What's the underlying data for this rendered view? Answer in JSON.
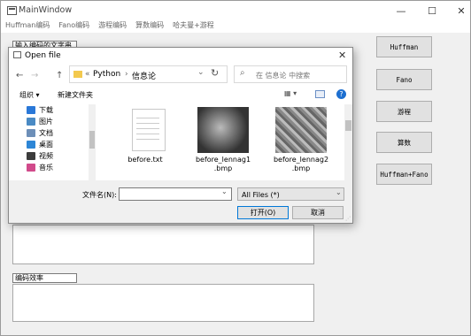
{
  "window": {
    "title": "MainWindow",
    "min": "—",
    "max": "☐",
    "close": "✕"
  },
  "menu": [
    "Huffman编码",
    "Fano编码",
    "游程编码",
    "算数编码",
    "哈夫曼+游程"
  ],
  "main": {
    "input_label": "输入编码的文字串",
    "efficiency_label": "编码效率"
  },
  "buttons": {
    "huffman": "Huffman",
    "fano": "Fano",
    "rle": "游程",
    "arith": "算数",
    "huff_rle": "Huffman+Fano"
  },
  "dialog": {
    "title": "Open file",
    "back": "←",
    "forward": "→",
    "up": "↑",
    "path": {
      "sep1": "«",
      "folder": "Python",
      "sep2": "›",
      "current": "信息论",
      "chevron": "⌄"
    },
    "refresh": "↻",
    "search_placeholder": "在 信息论 中搜索",
    "toolbar": {
      "organize": "组织 ▾",
      "new_folder": "新建文件夹",
      "view": "▦ ▾",
      "help": "?"
    },
    "nav_items": [
      {
        "label": "下载",
        "color": "#2a78d8"
      },
      {
        "label": "图片",
        "color": "#4a8ac4"
      },
      {
        "label": "文档",
        "color": "#6d8fb8"
      },
      {
        "label": "桌面",
        "color": "#2d86d6"
      },
      {
        "label": "视频",
        "color": "#3c3c3c"
      },
      {
        "label": "音乐",
        "color": "#d14a8b"
      }
    ],
    "files": [
      {
        "name": "before.txt"
      },
      {
        "name": "before_lennag1\n.bmp"
      },
      {
        "name": "before_lennag2\n.bmp"
      }
    ],
    "filename_label": "文件名(N):",
    "filename_value": "",
    "filetype": "All Files (*)",
    "open_btn": "打开(O)",
    "cancel_btn": "取消"
  }
}
